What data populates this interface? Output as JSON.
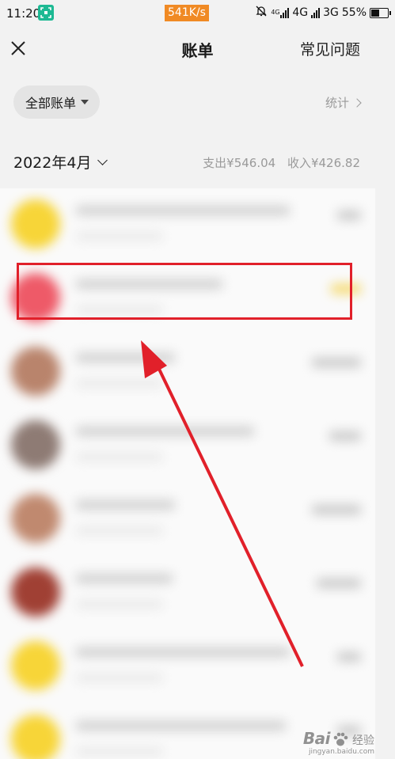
{
  "status_bar": {
    "time": "11:20",
    "speed": "541K/s",
    "net1": "4G",
    "net2": "3G",
    "battery": "55%",
    "battery_level": 0.55
  },
  "header": {
    "title": "账单",
    "faq": "常见问题"
  },
  "filter": {
    "label": "全部账单",
    "stats": "统计"
  },
  "month": {
    "label": "2022年4月",
    "expense": "支出¥546.04",
    "income": "收入¥426.82"
  },
  "colors": {
    "highlight": "#e1202a",
    "speed_badge": "#f08a24",
    "scan_icon": "#1db993"
  },
  "list": [
    {
      "avatar_color": "#f7d538"
    },
    {
      "avatar_color": "#ee5a68",
      "amount_color": "#f5d96b"
    },
    {
      "avatar_color": "#b9846c"
    },
    {
      "avatar_color": "#8e7b74"
    },
    {
      "avatar_color": "#c0896f"
    },
    {
      "avatar_color": "#a04034"
    },
    {
      "avatar_color": "#f7d538"
    },
    {
      "avatar_color": "#f7d538"
    }
  ],
  "watermark": {
    "logo": "Bai",
    "text": "经验",
    "url": "jingyan.baidu.com"
  }
}
